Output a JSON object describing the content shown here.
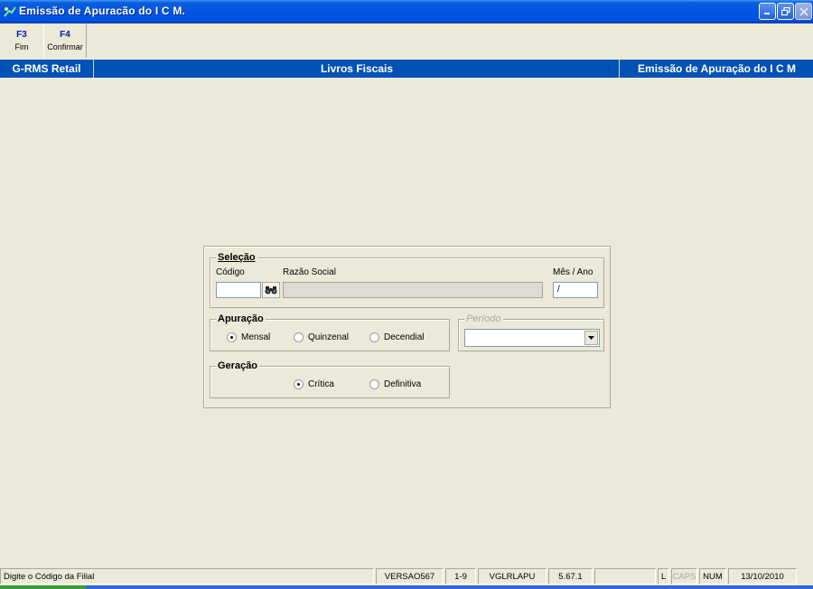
{
  "window": {
    "title": "Emissão de Apuracão do I C M."
  },
  "toolbar": {
    "f3": {
      "key": "F3",
      "label": "Fim"
    },
    "f4": {
      "key": "F4",
      "label": "Confirmar"
    }
  },
  "header": {
    "app": "G-RMS Retail",
    "module": "Livros Fiscais",
    "screen": "Emissão de Apuração do I C M"
  },
  "selecao": {
    "legend": "Seleção",
    "codigo_label": "Código",
    "razao_label": "Razão Social",
    "mesano_label": "Mês / Ano",
    "codigo_value": "",
    "razao_value": "",
    "mesano_value": "/"
  },
  "apuracao": {
    "legend": "Apuração",
    "options": [
      "Mensal",
      "Quinzenal",
      "Decendial"
    ],
    "selected": "Mensal"
  },
  "periodo": {
    "legend": "Período",
    "value": ""
  },
  "geracao": {
    "legend": "Geração",
    "options": [
      "Crítica",
      "Definitiva"
    ],
    "selected": "Crítica"
  },
  "status": {
    "message": "Digite o Código da Filial",
    "version": "VERSAO567",
    "range": "1-9",
    "program": "VGLRLAPU",
    "build": "5.67.1",
    "blank": "",
    "l": "L",
    "caps": "CAPS",
    "num": "NUM",
    "date": "13/10/2010"
  },
  "colors": {
    "band": "#0052b5",
    "titlebar": "#0054e3",
    "background": "#ece9d8"
  }
}
